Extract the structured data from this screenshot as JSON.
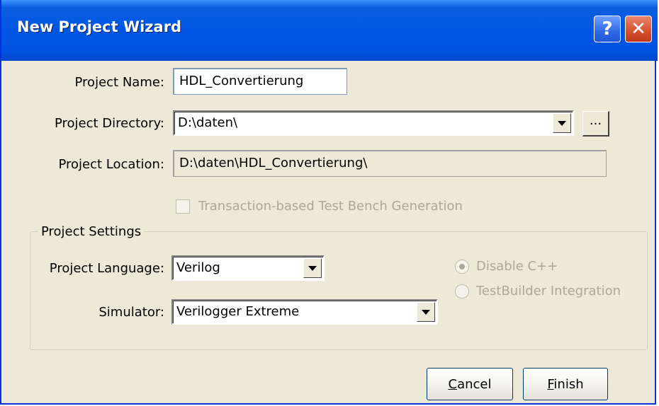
{
  "window": {
    "title": "New Project Wizard",
    "help_symbol": "?",
    "close_symbol": "✕"
  },
  "fields": {
    "project_name": {
      "label": "Project Name:",
      "value": "HDL_Convertierung"
    },
    "project_directory": {
      "label": "Project Directory:",
      "value": "D:\\daten\\",
      "browse_label": "..."
    },
    "project_location": {
      "label": "Project Location:",
      "value": "D:\\daten\\HDL_Convertierung\\"
    }
  },
  "transaction_checkbox": {
    "label": "Transaction-based Test Bench Generation",
    "checked": false,
    "enabled": false
  },
  "project_settings": {
    "legend": "Project Settings",
    "language": {
      "label": "Project Language:",
      "value": "Verilog"
    },
    "simulator": {
      "label": "Simulator:",
      "value": "Verilogger Extreme"
    },
    "radios": [
      {
        "label": "Disable C++",
        "checked": true,
        "enabled": false
      },
      {
        "label": "TestBuilder Integration",
        "checked": false,
        "enabled": false
      }
    ]
  },
  "buttons": {
    "cancel_prefix": "C",
    "cancel_rest": "ancel",
    "finish_prefix": "F",
    "finish_rest": "inish"
  },
  "colors": {
    "titlebar": "#0054e3",
    "dialog_bg": "#ece9d8",
    "disabled_text": "#aca899"
  }
}
